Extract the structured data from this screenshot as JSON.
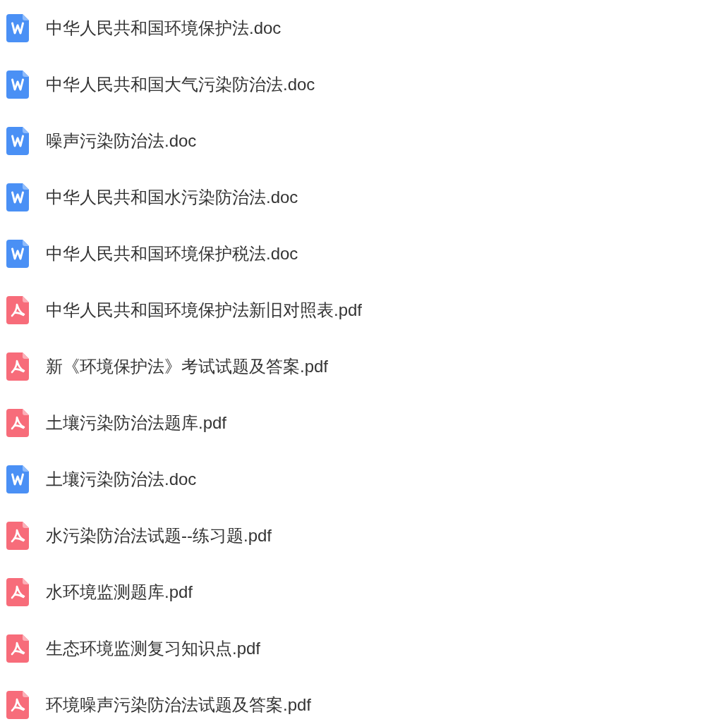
{
  "files": [
    {
      "kind": "doc",
      "name": "中华人民共和国环境保护法.doc"
    },
    {
      "kind": "doc",
      "name": "中华人民共和国大气污染防治法.doc"
    },
    {
      "kind": "doc",
      "name": "噪声污染防治法.doc"
    },
    {
      "kind": "doc",
      "name": "中华人民共和国水污染防治法.doc"
    },
    {
      "kind": "doc",
      "name": "中华人民共和国环境保护税法.doc"
    },
    {
      "kind": "pdf",
      "name": "中华人民共和国环境保护法新旧对照表.pdf"
    },
    {
      "kind": "pdf",
      "name": "新《环境保护法》考试试题及答案.pdf"
    },
    {
      "kind": "pdf",
      "name": "土壤污染防治法题库.pdf"
    },
    {
      "kind": "doc",
      "name": "土壤污染防治法.doc"
    },
    {
      "kind": "pdf",
      "name": "水污染防治法试题--练习题.pdf"
    },
    {
      "kind": "pdf",
      "name": "水环境监测题库.pdf"
    },
    {
      "kind": "pdf",
      "name": "生态环境监测复习知识点.pdf"
    },
    {
      "kind": "pdf",
      "name": "环境噪声污染防治法试题及答案.pdf"
    }
  ]
}
